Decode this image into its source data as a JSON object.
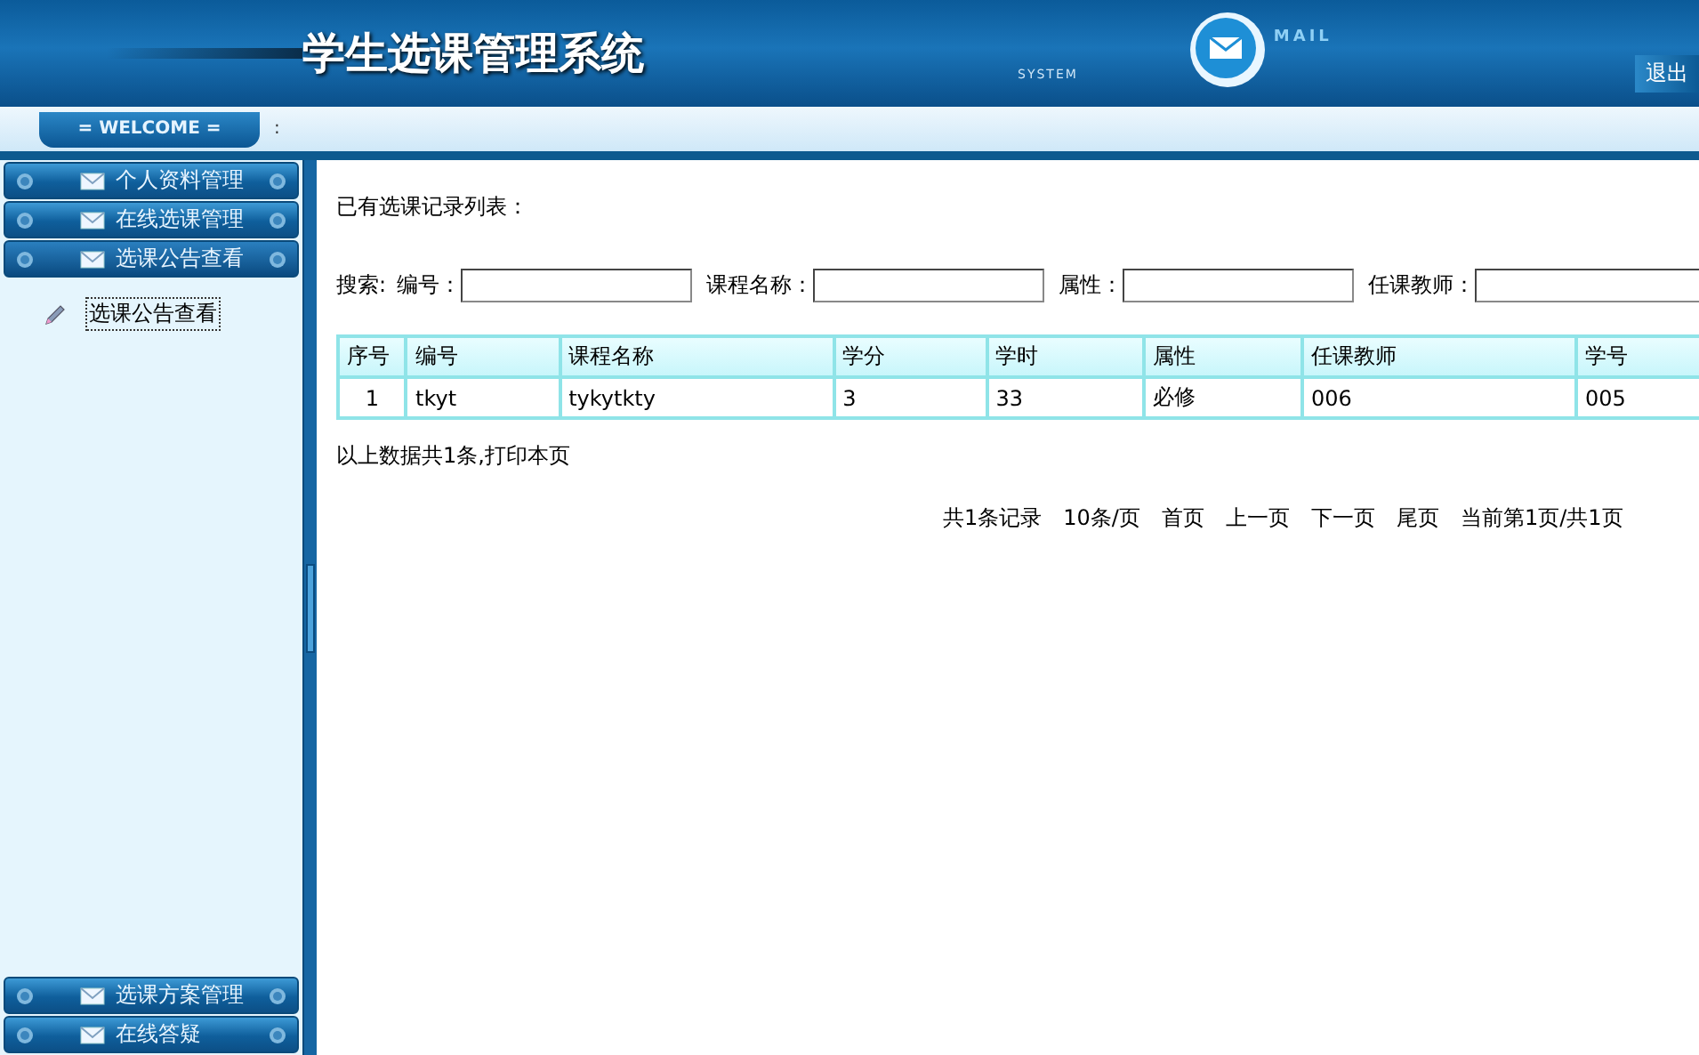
{
  "header": {
    "title": "学生选课管理系统",
    "system_label": "SYSTEM",
    "mail_label": "MAIL",
    "logout": "退出"
  },
  "welcome_bar": {
    "badge": "= WELCOME =",
    "suffix": ":"
  },
  "sidebar": {
    "top_menus": [
      {
        "label": "个人资料管理",
        "expanded": false
      },
      {
        "label": "在线选课管理",
        "expanded": false
      },
      {
        "label": "选课公告查看",
        "expanded": true,
        "children": [
          {
            "label": "选课公告查看",
            "selected": true
          }
        ]
      }
    ],
    "bottom_menus": [
      {
        "label": "选课方案管理",
        "expanded": false
      },
      {
        "label": "在线答疑",
        "expanded": false
      }
    ]
  },
  "content": {
    "heading": "已有选课记录列表：",
    "search": {
      "label": "搜索:",
      "fields": [
        {
          "label": "编号："
        },
        {
          "label": "课程名称："
        },
        {
          "label": "属性："
        },
        {
          "label": "任课教师："
        }
      ]
    },
    "table": {
      "columns": [
        "序号",
        "编号",
        "课程名称",
        "学分",
        "学时",
        "属性",
        "任课教师",
        "学号"
      ],
      "rows": [
        [
          "1",
          "tkyt",
          "tykytkty",
          "3",
          "33",
          "必修",
          "006",
          "005"
        ]
      ]
    },
    "summary": "以上数据共1条,打印本页",
    "pagination": [
      "共1条记录",
      "10条/页",
      "首页",
      "上一页",
      "下一页",
      "尾页",
      "当前第1页/共1页"
    ]
  }
}
